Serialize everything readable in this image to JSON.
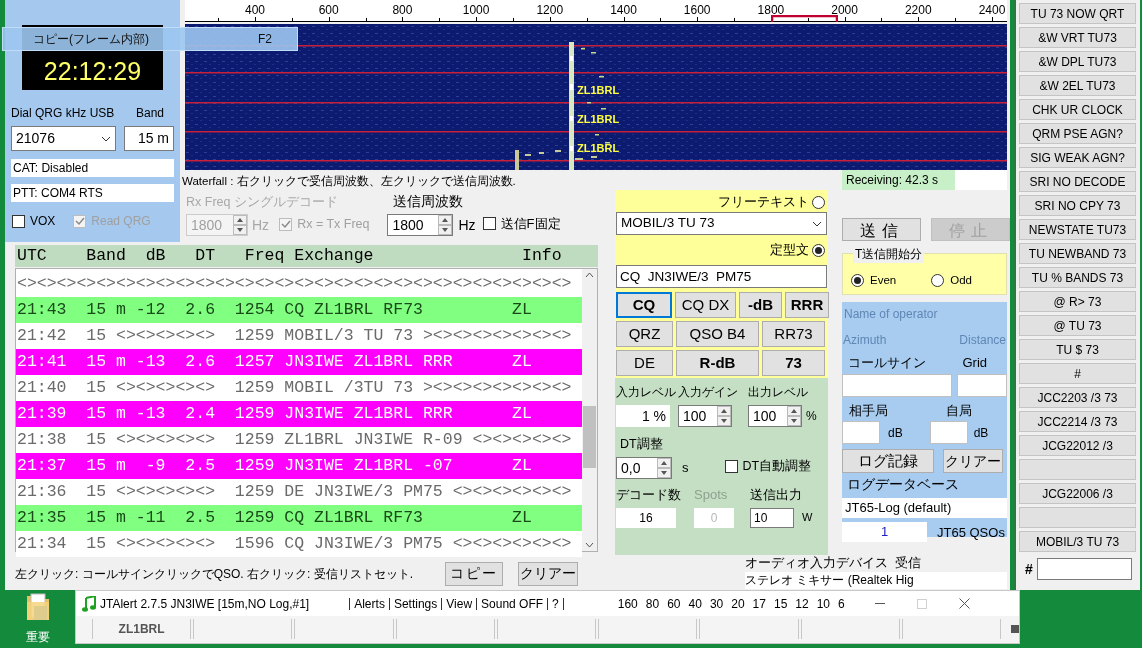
{
  "overlay": {
    "label": "コピー(フレーム内部)",
    "shortcut": "F2"
  },
  "clock": {
    "time": "22:12:29"
  },
  "radio": {
    "dial_label": "Dial QRG kHz USB",
    "band_label": "Band",
    "dial": "21076",
    "band": "15 m",
    "cat": "CAT: Disabled",
    "ptt": "PTT: COM4 RTS",
    "checks": [
      {
        "label": "VOX",
        "checked": false,
        "disabled": false
      },
      {
        "label": "Read QRG",
        "checked": true,
        "disabled": true
      }
    ]
  },
  "waterfall": {
    "scale": [
      "400",
      "600",
      "800",
      "1000",
      "1200",
      "1400",
      "1600",
      "1800",
      "2000",
      "2200",
      "2400"
    ],
    "signal_labels": [
      "ZL1BRL",
      "ZL1BRL",
      "ZL1BRL"
    ],
    "hint": "Waterfall : 右クリックで受信周波数、左クリックで送信周波数."
  },
  "receiving": "Receiving: 42.3 s",
  "rx_freq": {
    "label": "Rx Freq シングルデコード",
    "value": "1800",
    "unit": "Hz",
    "disabled": true,
    "check": {
      "label": "Rx = Tx Freq",
      "checked": true,
      "disabled": true
    }
  },
  "tx_freq": {
    "label": "送信周波数",
    "value": "1800",
    "unit": "Hz",
    "check": {
      "label": "送信F固定",
      "checked": false
    }
  },
  "decodes": {
    "header": "UTC    Band  dB   DT   Freq Exchange               Info",
    "rows": [
      {
        "kind": "plain",
        "text": "<><><><><><><><><><><><><><><><><><><><><><><><><><><><>"
      },
      {
        "kind": "cq",
        "text": "21:43  15 m -12  2.6  1254 CQ ZL1BRL RF73         ZL"
      },
      {
        "kind": "plain",
        "text": "21:42  15 <><><><><>  1259 MOBIL/3 TU 73 ><><><><><><><>"
      },
      {
        "kind": "to_me",
        "text": "21:41  15 m -13  2.6  1257 JN3IWE ZL1BRL RRR      ZL"
      },
      {
        "kind": "plain",
        "text": "21:40  15 <><><><><>  1259 MOBIL /3TU 73 ><><><><><><><>"
      },
      {
        "kind": "to_me",
        "text": "21:39  15 m -13  2.4  1259 JN3IWE ZL1BRL RRR      ZL"
      },
      {
        "kind": "plain",
        "text": "21:38  15 <><><><><>  1259 ZL1BRL JN3IWE R-09 <><><><><>"
      },
      {
        "kind": "to_me",
        "text": "21:37  15 m  -9  2.5  1259 JN3IWE ZL1BRL -07      ZL"
      },
      {
        "kind": "plain",
        "text": "21:36  15 <><><><><>  1259 DE JN3IWE/3 PM75 <><><><><><>"
      },
      {
        "kind": "cq",
        "text": "21:35  15 m -11  2.5  1259 CQ ZL1BRL RF73         ZL"
      },
      {
        "kind": "plain",
        "text": "21:34  15 <><><><><>  1596 CQ JN3IWE/3 PM75 <><><><><><>"
      }
    ]
  },
  "list_hint": "左クリック: コールサインクリックでQSO. 右クリック: 受信リストセット.",
  "list_buttons": [
    "コピー",
    "クリアー"
  ],
  "message": {
    "free": {
      "label": "フリーテキスト",
      "selected": false,
      "value": "MOBIL/3 TU 73"
    },
    "std": {
      "label": "定型文",
      "selected": true,
      "value": "CQ  JN3IWE/3  PM75"
    }
  },
  "macro_rows": [
    [
      {
        "label": "CQ",
        "bold": true,
        "focused": true
      },
      {
        "label": "CQ DX",
        "bold": false,
        "focused": false
      },
      {
        "label": "-dB",
        "bold": true,
        "focused": false
      },
      {
        "label": "RRR",
        "bold": true,
        "focused": false
      }
    ],
    [
      {
        "label": "QRZ",
        "bold": false,
        "focused": false
      },
      {
        "label": "QSO B4",
        "bold": false,
        "focused": false
      },
      {
        "label": "RR73",
        "bold": false,
        "focused": false
      }
    ],
    [
      {
        "label": "DE",
        "bold": false,
        "focused": false
      },
      {
        "label": "R-dB",
        "bold": true,
        "focused": false
      },
      {
        "label": "73",
        "bold": true,
        "focused": false
      }
    ]
  ],
  "levels": {
    "labels": [
      "入力レベル",
      "入力ゲイン",
      "出力レベル"
    ],
    "input_level": "1 %",
    "gain": "100",
    "output": "100",
    "unit": "%"
  },
  "dt": {
    "label": "DT調整",
    "value": "0,0",
    "unit": "s",
    "auto": {
      "label": "DT自動調整",
      "checked": false
    }
  },
  "counts": {
    "labels": [
      {
        "text": "デコード数",
        "disabled": false
      },
      {
        "text": "Spots",
        "disabled": true
      },
      {
        "text": "送信出力",
        "disabled": false
      }
    ],
    "decodes": "16",
    "spots": "0",
    "power": "10",
    "power_unit": "W"
  },
  "tx_buttons": [
    {
      "label": "送信",
      "disabled": false
    },
    {
      "label": "停止",
      "disabled": true
    }
  ],
  "tx_period": {
    "title": "T送信開始分",
    "options": [
      {
        "label": "Even",
        "selected": true
      },
      {
        "label": "Odd",
        "selected": false
      }
    ]
  },
  "log": {
    "operator": "Name of operator",
    "azimuth": "Azimuth",
    "distance": "Distance",
    "call_label": "コールサイン",
    "grid_label": "Grid",
    "his_label": "相手局",
    "my_label": "自局",
    "his_unit": "dB",
    "my_unit": "dB",
    "buttons": [
      "ログ記録",
      "クリアー"
    ],
    "db_label": "ログデータベース",
    "db_name": "JT65-Log (default)",
    "qso_count": "1",
    "qso_label": "JT65 QSOs"
  },
  "audio": {
    "label": "オーディオ入力デバイス  受信",
    "device": "ステレオ ミキサー (Realtek Hig"
  },
  "quick_messages": [
    {
      "kind": "message",
      "label": "TU 73 NOW QRT"
    },
    {
      "kind": "message",
      "label": "&W VRT TU73"
    },
    {
      "kind": "message",
      "label": "&W DPL TU73"
    },
    {
      "kind": "message",
      "label": "&W 2EL TU73"
    },
    {
      "kind": "message",
      "label": "CHK UR CLOCK"
    },
    {
      "kind": "message",
      "label": "QRM PSE AGN?"
    },
    {
      "kind": "message",
      "label": "SIG WEAK AGN?"
    },
    {
      "kind": "message",
      "label": "SRI NO DECODE"
    },
    {
      "kind": "message",
      "label": "SRI NO CPY 73"
    },
    {
      "kind": "message",
      "label": "NEWSTATE TU73"
    },
    {
      "kind": "message",
      "label": "TU NEWBAND 73"
    },
    {
      "kind": "message",
      "label": "TU % BANDS 73"
    },
    {
      "kind": "message",
      "label": "@ R> 73"
    },
    {
      "kind": "message",
      "label": "@ TU 73"
    },
    {
      "kind": "message",
      "label": "TU $ 73"
    },
    {
      "kind": "message",
      "label": "#"
    },
    {
      "kind": "message",
      "label": "JCC2203 /3 73"
    },
    {
      "kind": "message",
      "label": "JCC2214 /3 73"
    },
    {
      "kind": "message",
      "label": "JCG22012 /3"
    },
    {
      "kind": "blank"
    },
    {
      "kind": "message",
      "label": "JCG22006 /3"
    },
    {
      "kind": "blank"
    },
    {
      "kind": "message",
      "label": "MOBIL/3 TU 73"
    }
  ],
  "quick_input_label": "#",
  "desktop_icon": {
    "label": "重要"
  },
  "jtalert": {
    "title": "JTAlert 2.7.5 JN3IWE [15m,NO Log,#1]",
    "menu": [
      "Alerts",
      "Settings",
      "View",
      "Sound OFF",
      "?"
    ],
    "bands": [
      "160",
      "80",
      "60",
      "40",
      "30",
      "20",
      "17",
      "15",
      "12",
      "10",
      "6"
    ],
    "cells": [
      {
        "kind": "call",
        "call": "ZL1BRL"
      },
      {
        "kind": "blank"
      },
      {
        "kind": "blank"
      },
      {
        "kind": "blank"
      },
      {
        "kind": "blank"
      },
      {
        "kind": "blank"
      },
      {
        "kind": "blank"
      },
      {
        "kind": "blank"
      },
      {
        "kind": "blank"
      }
    ]
  }
}
